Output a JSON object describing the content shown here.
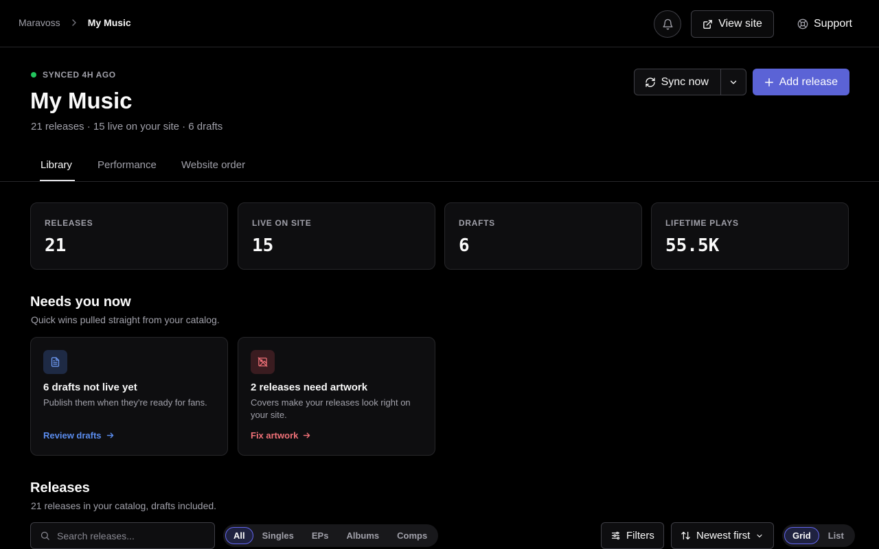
{
  "breadcrumb": {
    "root": "Maravoss",
    "current": "My Music"
  },
  "top_actions": {
    "view_site": "View site",
    "support": "Support"
  },
  "header": {
    "sync_status": "SYNCED 4H AGO",
    "title": "My Music",
    "subtitle": "21 releases · 15 live on your site · 6 drafts",
    "sync_button": "Sync now",
    "add_button": "Add release"
  },
  "tabs": [
    {
      "label": "Library",
      "active": true
    },
    {
      "label": "Performance",
      "active": false
    },
    {
      "label": "Website order",
      "active": false
    }
  ],
  "stats": [
    {
      "label": "RELEASES",
      "value": "21"
    },
    {
      "label": "LIVE ON SITE",
      "value": "15"
    },
    {
      "label": "DRAFTS",
      "value": "6"
    },
    {
      "label": "LIFETIME PLAYS",
      "value": "55.5K"
    }
  ],
  "needs": {
    "title": "Needs you now",
    "subtitle": "Quick wins pulled straight from your catalog.",
    "cards": [
      {
        "icon": "document-icon",
        "title": "6 drafts not live yet",
        "description": "Publish them when they're ready for fans.",
        "link": "Review drafts",
        "accent": "#5b8def"
      },
      {
        "icon": "image-off-icon",
        "title": "2 releases need artwork",
        "description": "Covers make your releases look right on your site.",
        "link": "Fix artwork",
        "accent": "#f07178"
      }
    ]
  },
  "releases": {
    "title": "Releases",
    "subtitle": "21 releases in your catalog, drafts included.",
    "search_placeholder": "Search releases...",
    "type_filters": [
      "All",
      "Singles",
      "EPs",
      "Albums",
      "Comps"
    ],
    "active_type": "All",
    "filters_label": "Filters",
    "sort_label": "Newest first",
    "view_options": [
      "Grid",
      "List"
    ],
    "active_view": "Grid"
  },
  "colors": {
    "accent": "#5b63d6",
    "status_ok": "#22c55e",
    "link_blue": "#5b8def",
    "link_red": "#f07178"
  }
}
